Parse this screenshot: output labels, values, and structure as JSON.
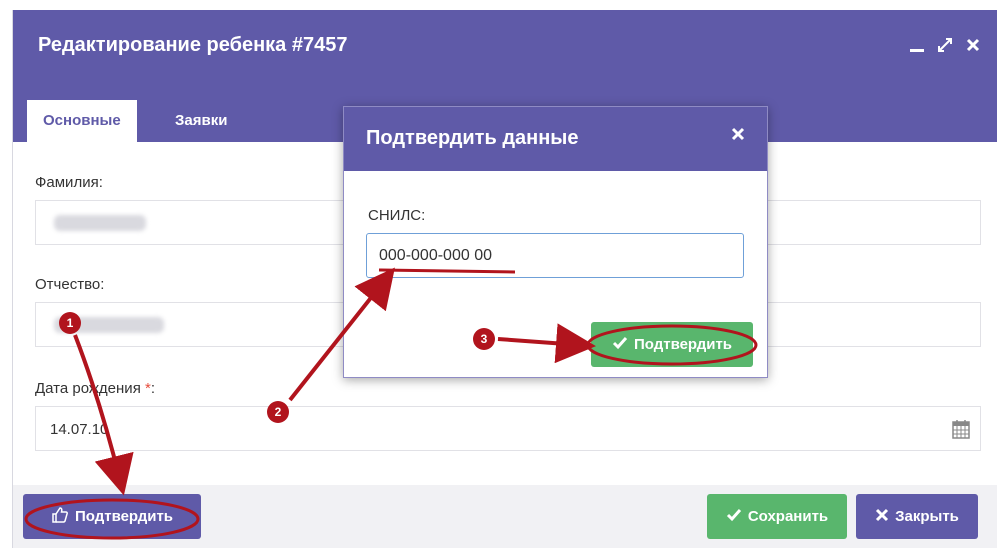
{
  "window": {
    "title": "Редактирование ребенка #7457",
    "controls": [
      "minimize-icon",
      "expand-icon",
      "close-icon"
    ]
  },
  "tabs": [
    {
      "label": "Основные",
      "active": true
    },
    {
      "label": "Заявки",
      "active": false
    }
  ],
  "form": {
    "surname_label": "Фамилия:",
    "patronymic_label": "Отчество:",
    "birthdate_label": "Дата рождения",
    "required_mark": "*",
    "label_colon": ":",
    "birthdate_value": "14.07.10",
    "calendar_icon": "calendar-icon"
  },
  "footer": {
    "confirm_label": "Подтвердить",
    "save_label": "Сохранить",
    "close_label": "Закрыть"
  },
  "modal": {
    "title": "Подтвердить данные",
    "snils_label": "СНИЛС:",
    "snils_value": "000-000-000 00",
    "confirm_label": "Подтвердить"
  },
  "annotations": {
    "badges": [
      "1",
      "2",
      "3"
    ],
    "accent_color": "#b1141d"
  },
  "colors": {
    "header": "#5f5aa8",
    "success": "#59b66d",
    "footer_bg": "#f1f1f4"
  }
}
